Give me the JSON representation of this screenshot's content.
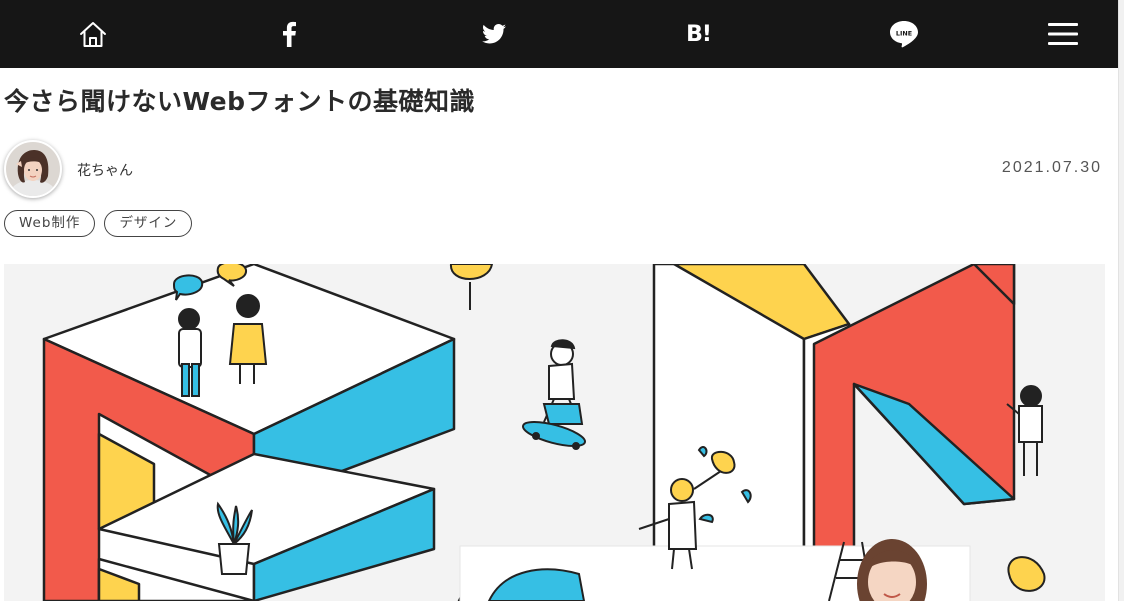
{
  "nav": {
    "items": [
      {
        "name": "home",
        "icon": "home-icon"
      },
      {
        "name": "facebook",
        "icon": "facebook-icon",
        "label": "f"
      },
      {
        "name": "twitter",
        "icon": "twitter-icon"
      },
      {
        "name": "hatena",
        "icon": "hatena-bookmark-icon",
        "label": "B!"
      },
      {
        "name": "line",
        "icon": "line-icon",
        "label": "LINE"
      },
      {
        "name": "menu",
        "icon": "hamburger-menu-icon"
      }
    ],
    "background": "#161616"
  },
  "article": {
    "title": "今さら聞けないWebフォントの基礎知識",
    "author": "花ちゃん",
    "date": "2021.07.30",
    "tags": [
      "Web制作",
      "デザイン"
    ]
  },
  "hero": {
    "description_colors": {
      "red": "#f25a4b",
      "blue": "#36bfe4",
      "yellow": "#fed34e",
      "outline": "#222222"
    }
  }
}
